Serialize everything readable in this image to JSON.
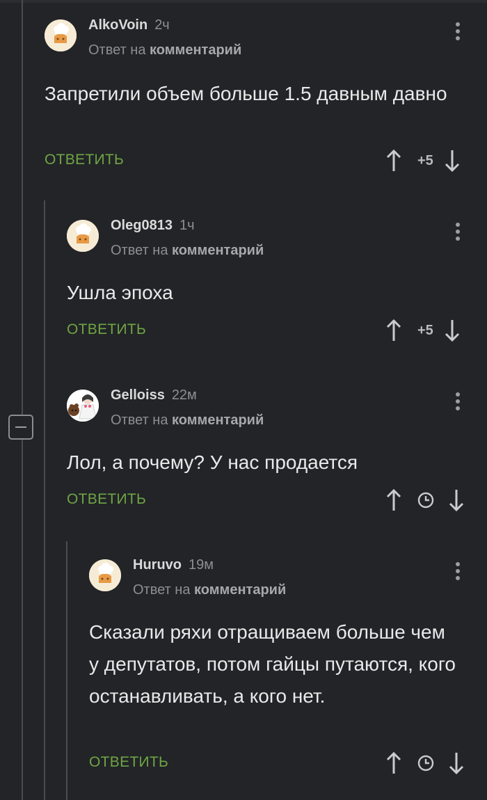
{
  "comments": [
    {
      "author": "AlkoVoin",
      "time": "2ч",
      "reply_prefix": "Ответ на",
      "reply_target": "комментарий",
      "body": "Запретили объем больше 1.5 давным давно",
      "reply_label": "ОТВЕТИТЬ",
      "score": "+5"
    },
    {
      "author": "Oleg0813",
      "time": "1ч",
      "reply_prefix": "Ответ на",
      "reply_target": "комментарий",
      "body": "Ушла эпоха",
      "reply_label": "ОТВЕТИТЬ",
      "score": "+5"
    },
    {
      "author": "Gelloiss",
      "time": "22м",
      "reply_prefix": "Ответ на",
      "reply_target": "комментарий",
      "body": "Лол, а почему? У нас продается",
      "reply_label": "ОТВЕТИТЬ",
      "score_icon": "clock-icon"
    },
    {
      "author": "Huruvo",
      "time": "19м",
      "reply_prefix": "Ответ на",
      "reply_target": "комментарий",
      "body": "Сказали ряхи отращиваем больше чем у депутатов, потом гайцы путаются, кого останавливать, а кого нет.",
      "reply_label": "ОТВЕТИТЬ",
      "score_icon": "clock-icon"
    }
  ],
  "colors": {
    "background": "#222427",
    "reply_green": "#6fa545",
    "muted": "#8d8f93",
    "thread_line": "#4a4c50"
  }
}
